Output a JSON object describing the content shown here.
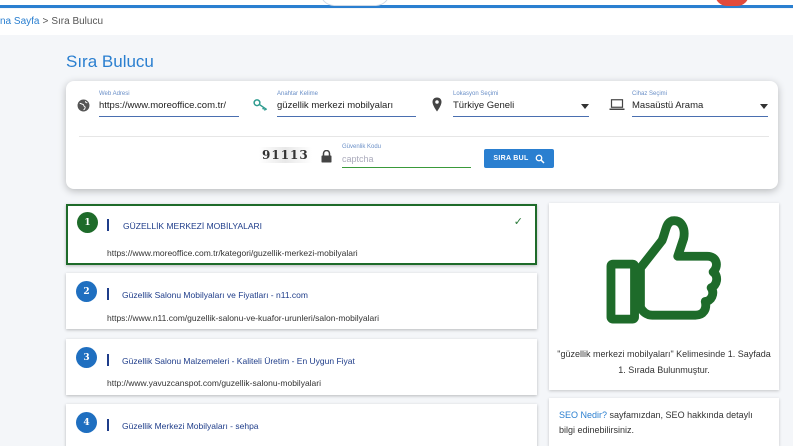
{
  "breadcrumb": {
    "home": "na Sayfa",
    "separator": ">",
    "current": "Sıra Bulucu"
  },
  "page_title": "Sıra Bulucu",
  "form": {
    "web_address": {
      "label": "Web Adresi",
      "value": "https://www.moreoffice.com.tr/"
    },
    "keyword": {
      "label": "Anahtar Kelime",
      "value": "güzellik merkezi mobilyaları"
    },
    "location": {
      "label": "Lokasyon Seçimi",
      "value": "Türkiye Geneli"
    },
    "device": {
      "label": "Cihaz Seçimi",
      "value": "Masaüstü Arama"
    },
    "captcha_image": "91113",
    "security": {
      "label": "Güvenlik Kodu",
      "placeholder": "captcha"
    },
    "search_button": "SIRA BUL"
  },
  "results": [
    {
      "number": "1",
      "title": "GÜZELLİK MERKEZİ MOBİLYALARI",
      "url": "https://www.moreoffice.com.tr/kategori/guzellik-merkezi-mobilyalari",
      "highlight": true
    },
    {
      "number": "2",
      "title": "Güzellik Salonu Mobilyaları ve Fiyatları - n11.com",
      "url": "https://www.n11.com/guzellik-salonu-ve-kuafor-urunleri/salon-mobilyalari",
      "highlight": false
    },
    {
      "number": "3",
      "title": "Güzellik Salonu Malzemeleri - Kaliteli Üretim - En Uygun Fiyat",
      "url": "http://www.yavuzcanspot.com/guzellik-salonu-mobilyalari",
      "highlight": false
    },
    {
      "number": "4",
      "title": "Güzellik Merkezi Mobilyaları - sehpa",
      "url": "",
      "highlight": false
    }
  ],
  "result_card": {
    "text": "\"güzellik merkezi mobilyaları\" Kelimesinde 1. Sayfada 1. Sırada Bulunmuştur."
  },
  "seo_card": {
    "link": "SEO Nedir?",
    "text": " sayfamızdan, SEO hakkında detaylı bilgi edinebilirsiniz."
  },
  "colors": {
    "accent": "#2a7fd0",
    "success": "#1e6b2a",
    "number_blue": "#1f6fc0"
  }
}
